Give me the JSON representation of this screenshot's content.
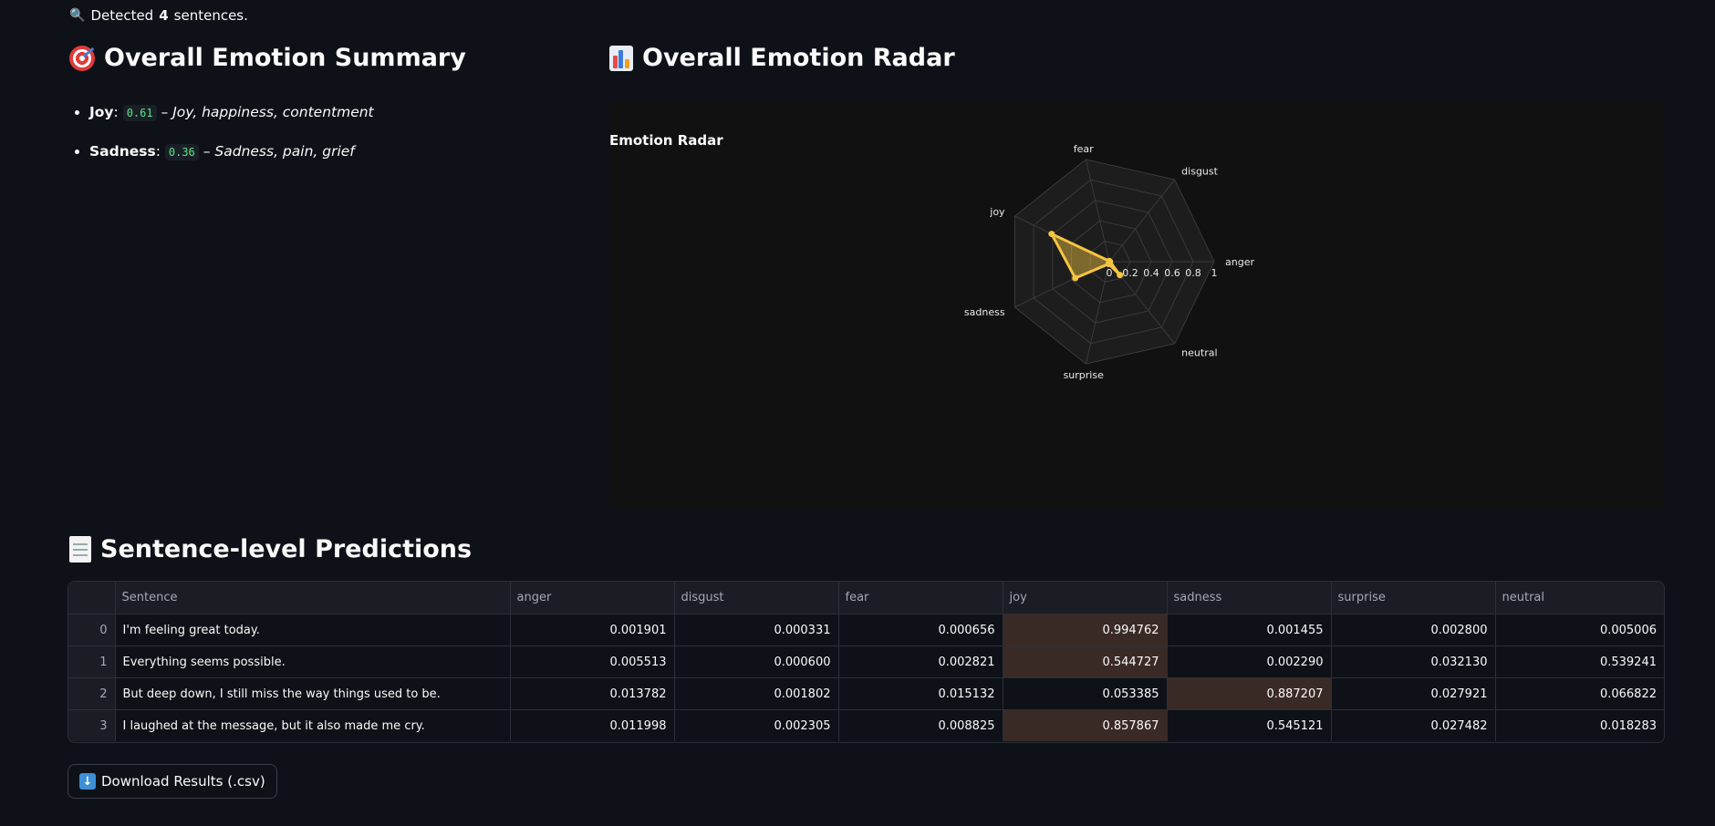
{
  "status": {
    "prefix": "Detected",
    "count": "4",
    "suffix": "sentences.",
    "icon": "magnifier-icon"
  },
  "summary": {
    "title": "Overall Emotion Summary",
    "icon": "target-icon",
    "items": [
      {
        "label": "Joy",
        "value": "0.61",
        "description": "Joy, happiness, contentment"
      },
      {
        "label": "Sadness",
        "value": "0.36",
        "description": "Sadness, pain, grief"
      }
    ]
  },
  "radar": {
    "title": "Overall Emotion Radar",
    "icon": "bar-chart-icon",
    "chart_title": "Emotion Radar"
  },
  "chart_data": {
    "type": "radar",
    "title": "Emotion Radar",
    "axes": [
      "anger",
      "disgust",
      "fear",
      "joy",
      "sadness",
      "surprise",
      "neutral"
    ],
    "values": [
      0.0068,
      0.0013,
      0.0069,
      0.61,
      0.36,
      0.0226,
      0.1624
    ],
    "radial_ticks": [
      "0",
      "0.2",
      "0.4",
      "0.6",
      "0.8",
      "1"
    ],
    "range": [
      0,
      1
    ],
    "color": "#f5c542"
  },
  "predictions": {
    "title": "Sentence-level Predictions",
    "icon": "document-icon",
    "columns": [
      "",
      "Sentence",
      "anger",
      "disgust",
      "fear",
      "joy",
      "sadness",
      "surprise",
      "neutral"
    ],
    "rows": [
      {
        "index": "0",
        "sentence": "I'm feeling great today.",
        "anger": "0.001901",
        "disgust": "0.000331",
        "fear": "0.000656",
        "joy": "0.994762",
        "sadness": "0.001455",
        "surprise": "0.002800",
        "neutral": "0.005006",
        "highlight": "joy"
      },
      {
        "index": "1",
        "sentence": "Everything seems possible.",
        "anger": "0.005513",
        "disgust": "0.000600",
        "fear": "0.002821",
        "joy": "0.544727",
        "sadness": "0.002290",
        "surprise": "0.032130",
        "neutral": "0.539241",
        "highlight": "joy"
      },
      {
        "index": "2",
        "sentence": "But deep down, I still miss the way things used to be.",
        "anger": "0.013782",
        "disgust": "0.001802",
        "fear": "0.015132",
        "joy": "0.053385",
        "sadness": "0.887207",
        "surprise": "0.027921",
        "neutral": "0.066822",
        "highlight": "sadness"
      },
      {
        "index": "3",
        "sentence": "I laughed at the message, but it also made me cry.",
        "anger": "0.011998",
        "disgust": "0.002305",
        "fear": "0.008825",
        "joy": "0.857867",
        "sadness": "0.545121",
        "surprise": "0.027482",
        "neutral": "0.018283",
        "highlight": "joy"
      }
    ]
  },
  "download": {
    "label": "Download Results (.csv)",
    "icon": "download-arrow-icon"
  },
  "colors": {
    "background": "#0e1117",
    "highlight": "#3a2a26",
    "code_text": "#5ce488",
    "radar_fill": "#f5c542"
  }
}
